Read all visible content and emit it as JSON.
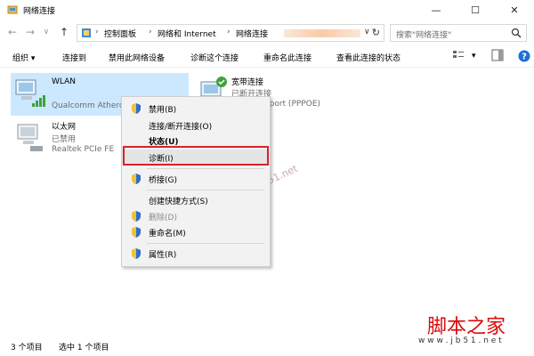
{
  "window": {
    "title": "网络连接",
    "minimize": "—",
    "maximize": "☐",
    "close": "✕"
  },
  "nav": {
    "back": "←",
    "forward": "→",
    "dropdown": "∨",
    "up": "↑"
  },
  "address": {
    "crumbs": [
      "控制面板",
      "网络和 Internet",
      "网络连接"
    ],
    "separator": "›",
    "refresh": "↻"
  },
  "search": {
    "placeholder": "搜索\"网络连接\""
  },
  "toolbar": {
    "organize": "组织 ▾",
    "connect_to": "连接到",
    "disable_device": "禁用此网络设备",
    "diagnose": "诊断这个连接",
    "rename": "重命名此连接",
    "view_status": "查看此连接的状态",
    "view_dropdown": "▾"
  },
  "connections": [
    {
      "name": "WLAN",
      "sub": "Qualcomm Athero"
    },
    {
      "name": "宽带连接",
      "status": "已断开连接",
      "sub": "WAN Miniport (PPPOE)"
    },
    {
      "name": "以太网",
      "status": "已禁用",
      "sub": "Realtek PCIe FE"
    }
  ],
  "context_menu": {
    "disable": "禁用(B)",
    "connect_disconnect": "连接/断开连接(O)",
    "status": "状态(U)",
    "diagnose": "诊断(I)",
    "bridge": "桥接(G)",
    "create_shortcut": "创建快捷方式(S)",
    "delete": "删除(D)",
    "rename": "重命名(M)",
    "properties": "属性(R)"
  },
  "statusbar": {
    "item_count": "3 个项目",
    "selected": "选中 1 个项目"
  },
  "watermark": {
    "url": "www.jb51.net",
    "brand": "脚本之家",
    "brand_url": "w w w . j b 5 1 . n e t"
  },
  "colors": {
    "selection": "#cce8ff",
    "highlight_box": "#d9222a",
    "brand_red": "#d90a0a"
  }
}
